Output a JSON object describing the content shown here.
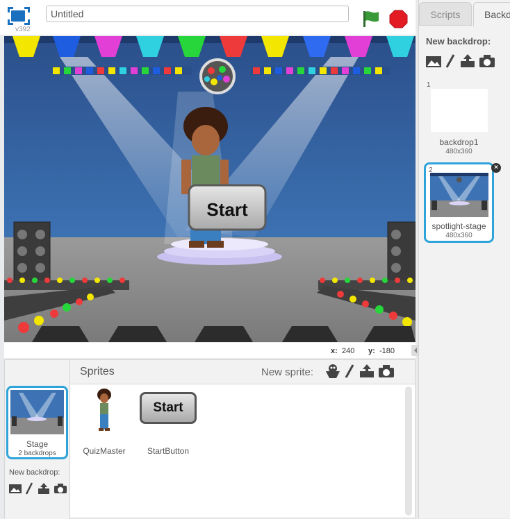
{
  "app": {
    "project_title": "Untitled",
    "version": "v392"
  },
  "stage": {
    "start_label": "Start",
    "coords": {
      "x_label": "x:",
      "x": "240",
      "y_label": "y:",
      "y": "-180"
    }
  },
  "sprites": {
    "title": "Sprites",
    "new_sprite_label": "New sprite:",
    "items": [
      {
        "name": "QuizMaster"
      },
      {
        "name": "StartButton",
        "button_text": "Start"
      }
    ],
    "stage_item": {
      "label": "Stage",
      "sub": "2 backdrops"
    },
    "new_backdrop_label": "New backdrop:"
  },
  "right_pane": {
    "tabs": [
      {
        "label": "Scripts"
      },
      {
        "label": "Backdrops"
      }
    ],
    "new_backdrop_label": "New backdrop:",
    "backdrops": [
      {
        "num": "1",
        "name": "backdrop1",
        "size": "480x360"
      },
      {
        "num": "2",
        "name": "spotlight-stage",
        "size": "480x360"
      }
    ]
  },
  "colors": {
    "accent": "#2fa4da",
    "flag": "#2e8c3a",
    "stop": "#e31b23",
    "stage_wall": "#2e5c9a"
  },
  "icons": [
    "fullscreen-icon",
    "green-flag-icon",
    "stop-icon",
    "paint-icon",
    "brush-icon",
    "upload-icon",
    "camera-icon",
    "sprite-library-icon",
    "delete-icon"
  ]
}
